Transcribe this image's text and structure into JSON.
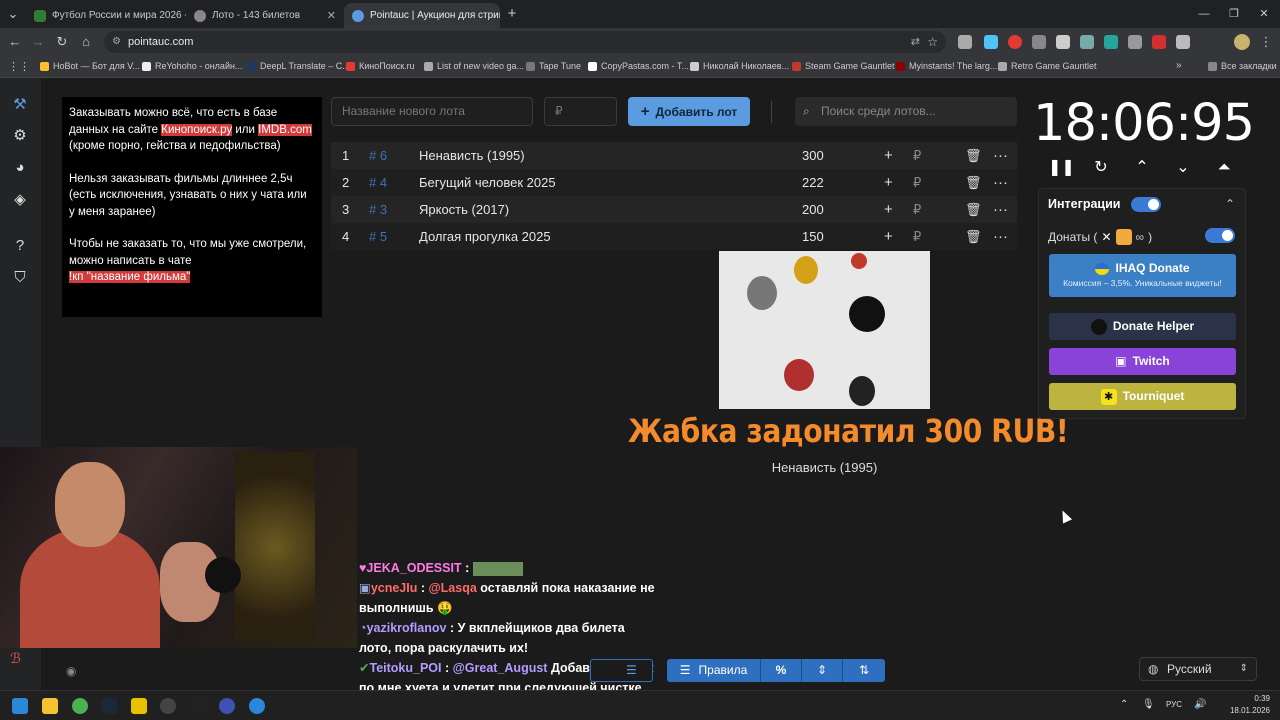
{
  "browser": {
    "tabs": [
      {
        "title": "Футбол России и мира 2026 -",
        "active": false
      },
      {
        "title": "Лото - 143 билетов",
        "active": false
      },
      {
        "title": "Pointauc | Аукцион для стрим",
        "active": true
      }
    ],
    "url": "pointauc.com",
    "bookmarks": [
      "HoBot — Бот для V...",
      "ReYohoho - онлайн...",
      "DeepL Translate – C...",
      "КиноПоиск.ru",
      "List of new video ga...",
      "Tape Tune",
      "CopyPastas.com - T...",
      "Николай Николаев...",
      "Steam Game Gauntlet",
      "Myinstants! The larg...",
      "Retro Game Gauntlet"
    ],
    "all_bookmarks": "Все закладки"
  },
  "rules": {
    "p1_before": "Заказывать можно всё, что есть в базе данных на сайте ",
    "p1_link1": "Кинопоиск.ру",
    "p1_mid": " или ",
    "p1_link2": "IMDB.com",
    "p1_after": " (кроме порно, гейства и педофильства)",
    "p2": "Нельзя заказывать фильмы длиннее 2,5ч (есть исключения, узнавать о них у чата или у меня заранее)",
    "p3": "Чтобы не заказать то, что мы уже смотрели, можно написать в чате",
    "p3_cmd": "!кп \"название фильма\""
  },
  "lot_form": {
    "name_placeholder": "Название нового лота",
    "amount_placeholder": "₽",
    "add_button": "Добавить лот",
    "search_placeholder": "Поиск среди лотов..."
  },
  "lots": [
    {
      "pos": "1",
      "id": "# 6",
      "name": "Ненависть (1995)",
      "amount": "300"
    },
    {
      "pos": "2",
      "id": "# 4",
      "name": "Бегущий человек 2025",
      "amount": "222"
    },
    {
      "pos": "3",
      "id": "# 3",
      "name": "Яркость (2017)",
      "amount": "200"
    },
    {
      "pos": "4",
      "id": "# 5",
      "name": "Долгая прогулка 2025",
      "amount": "150"
    }
  ],
  "lot_actions": {
    "plus": "+",
    "currency": "₽",
    "delete": "🗑",
    "more": "···"
  },
  "donation_alert": {
    "message": "Жабка задонатил 300 RUB!",
    "lot": "Ненависть (1995)"
  },
  "timer": {
    "value": "18:06:95"
  },
  "integrations": {
    "title": "Интеграции",
    "donations_label": "Донаты (",
    "donations_close": ")",
    "services": [
      {
        "name": "IHAQ Donate",
        "sub": "Комиссия – 3,5%. Уникальные виджеты!",
        "color": "#3b7fc4"
      },
      {
        "name": "Donate Helper",
        "color": "#2a3347"
      },
      {
        "name": "Twitch",
        "color": "#8a43d8"
      },
      {
        "name": "Tourniquet",
        "color": "#bdb43f"
      }
    ]
  },
  "chat": [
    {
      "user": "JEKA_ODESSIT",
      "text": ":"
    },
    {
      "user": "ycneJIu",
      "mention": "@Lasqa",
      "text": "оставляй пока наказание не выполнишь 🤑"
    },
    {
      "user": "yazikroflanov",
      "text": ": У вкплейщиков два билета лото, пора раскулачить их!"
    },
    {
      "user": "Teitoku_POI",
      "mention": "@Great_August",
      "text": "Добавлю, но как по мне хуета и улетит при следующей чистке"
    }
  ],
  "bottom_tools": {
    "rules_label": "Правила",
    "percent": "%"
  },
  "language": {
    "value": "Русский"
  },
  "taskbar": {
    "lang": "РУС",
    "time": "0:39",
    "date": "18.01.2026"
  }
}
